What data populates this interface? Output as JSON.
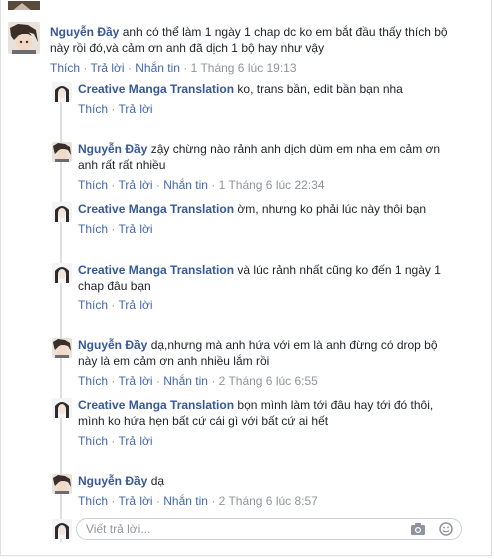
{
  "comment": {
    "author": "Nguyễn Đầy",
    "text_line1": "anh có thể làm 1 ngày 1 chap dc ko em bắt đầu thấy thích bộ",
    "text_line2": "này rồi đó,và cảm ơn anh đã dịch 1 bộ hay như vậy",
    "like": "Thích",
    "reply": "Trả lời",
    "message": "Nhắn tin",
    "time": "1 Tháng 6 lúc 19:13"
  },
  "replies": [
    {
      "author": "Creative Manga Translation",
      "line1": "ko, trans bần, edit bần bạn nha",
      "line2": "",
      "like": "Thích",
      "reply": "Trả lời",
      "message": "",
      "time": ""
    },
    {
      "author": "Nguyễn Đầy",
      "line1": "zậy chừng nào rảnh anh dịch dùm em nha em cảm ơn",
      "line2": "anh rất rất nhiều",
      "like": "Thích",
      "reply": "Trả lời",
      "message": "Nhắn tin",
      "time": "1 Tháng 6 lúc 22:34"
    },
    {
      "author": "Creative Manga Translation",
      "line1": "ờm, nhưng ko phải lúc này thôi bạn",
      "line2": "",
      "like": "Thích",
      "reply": "Trả lời",
      "message": "",
      "time": ""
    },
    {
      "author": "Creative Manga Translation",
      "line1": "và lúc rảnh nhất cũng ko đến 1 ngày 1",
      "line2": "chap đâu bạn",
      "like": "Thích",
      "reply": "Trả lời",
      "message": "",
      "time": ""
    },
    {
      "author": "Nguyễn Đầy",
      "line1": "dạ,nhưng mà anh hứa với em là anh đừng có drop bộ",
      "line2": "này là em cảm ơn anh nhiều lắm rồi",
      "like": "Thích",
      "reply": "Trả lời",
      "message": "Nhắn tin",
      "time": "2 Tháng 6 lúc 6:55"
    },
    {
      "author": "Creative Manga Translation",
      "line1": "bọn mình làm tới đâu hay tới đó thôi,",
      "line2": "mình ko hứa hẹn bất cứ cái gì với bất cứ ai hết",
      "like": "Thích",
      "reply": "Trả lời",
      "message": "",
      "time": ""
    },
    {
      "author": "Nguyễn Đầy",
      "line1": "dạ",
      "line2": "",
      "like": "Thích",
      "reply": "Trả lời",
      "message": "Nhắn tin",
      "time": "2 Tháng 6 lúc 8:57"
    }
  ],
  "reply_box": {
    "placeholder": "Viết trả lời..."
  },
  "icons": {
    "camera": "camera-icon",
    "emoji": "emoji-icon"
  },
  "colors": {
    "link": "#365899",
    "action": "#4267b2",
    "meta": "#90949c"
  }
}
